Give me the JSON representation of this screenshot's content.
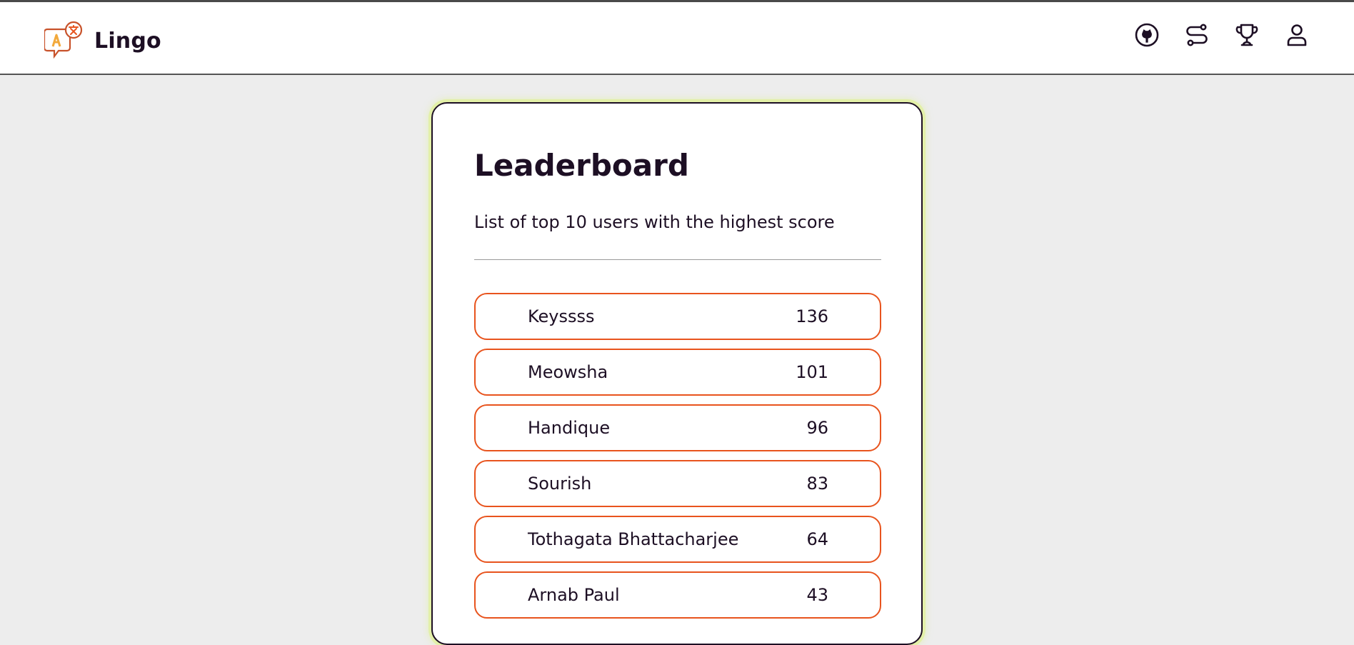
{
  "app": {
    "name": "Lingo"
  },
  "nav": {
    "icons": [
      "github-icon",
      "route-icon",
      "trophy-icon",
      "user-icon"
    ]
  },
  "colors": {
    "accent": "#e8541e",
    "text": "#1d0f24",
    "background": "#ededed",
    "card_glow": "#e3f0a8"
  },
  "leaderboard": {
    "title": "Leaderboard",
    "subtitle": "List of top 10 users with the highest score",
    "entries": [
      {
        "name": "Keyssss",
        "score": "136"
      },
      {
        "name": "Meowsha",
        "score": "101"
      },
      {
        "name": "Handique",
        "score": "96"
      },
      {
        "name": "Sourish",
        "score": "83"
      },
      {
        "name": "Tothagata Bhattacharjee",
        "score": "64"
      },
      {
        "name": "Arnab Paul",
        "score": "43"
      }
    ]
  }
}
